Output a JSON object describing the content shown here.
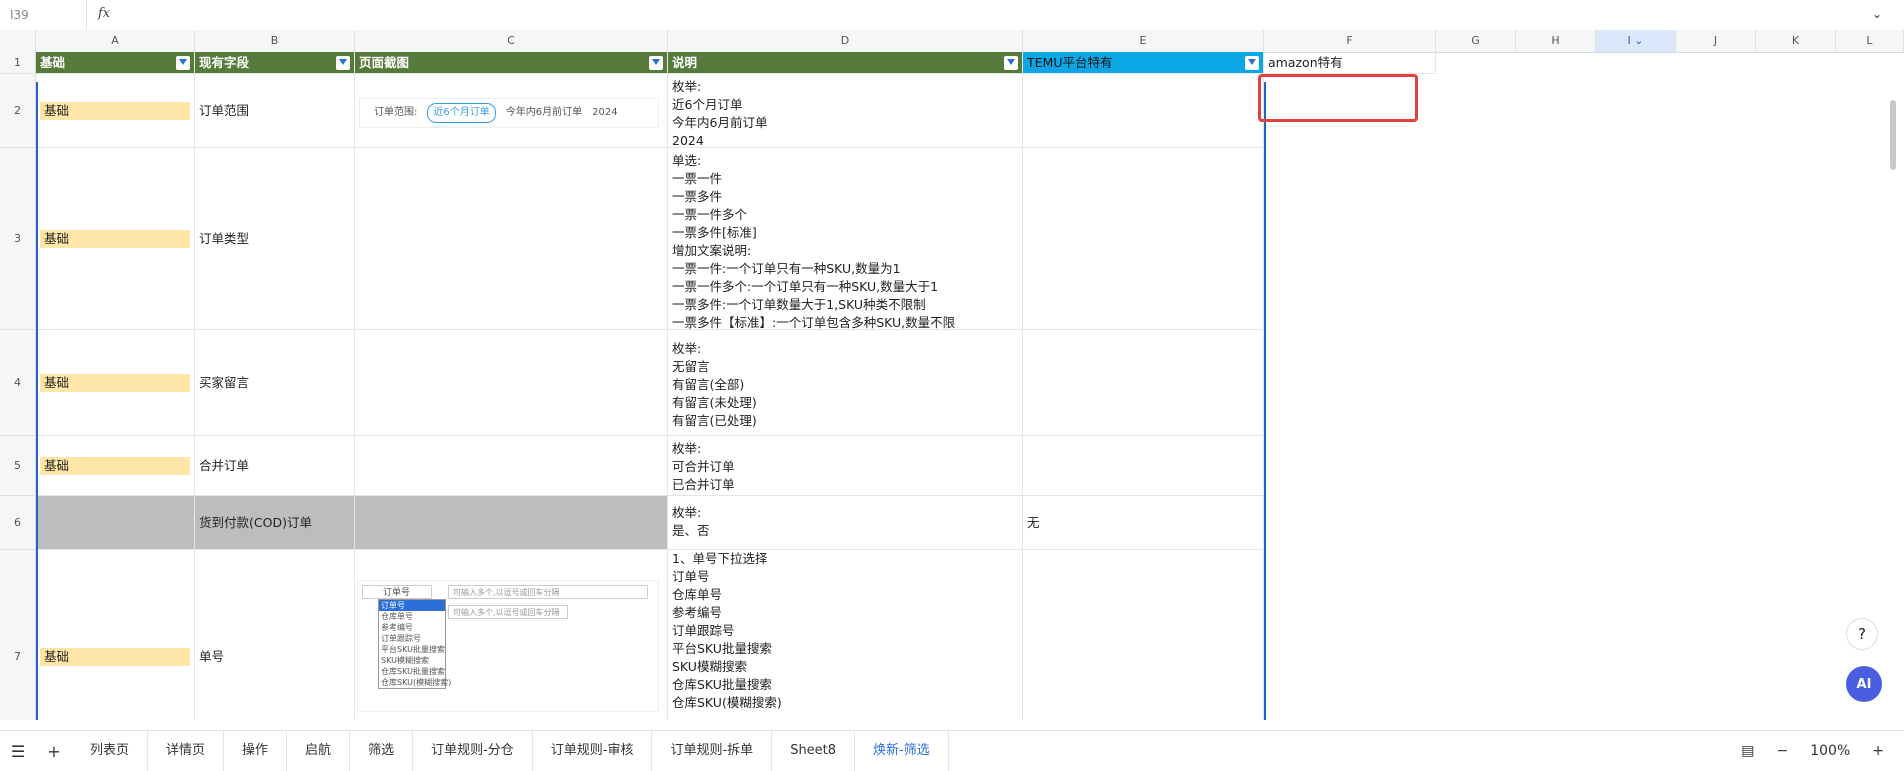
{
  "formula_bar": {
    "cell_ref": "I39",
    "fx": "fx"
  },
  "columns": [
    "A",
    "B",
    "C",
    "D",
    "E",
    "F",
    "G",
    "H",
    "I",
    "J",
    "K",
    "L"
  ],
  "rows": [
    "1",
    "2",
    "3",
    "4",
    "5",
    "6",
    "7"
  ],
  "header_row": {
    "a": "基础",
    "b": "现有字段",
    "c": "页面截图",
    "d": "说明",
    "e": "TEMU平台特有",
    "f": "amazon特有"
  },
  "data_rows": [
    {
      "a": "基础",
      "b": "订单范围",
      "d": "枚举:\n近6个月订单\n今年内6月前订单\n2024",
      "e": ""
    },
    {
      "a": "基础",
      "b": "订单类型",
      "d": "单选:\n一票一件\n一票多件\n一票一件多个\n一票多件[标准]\n增加文案说明:\n一票一件:一个订单只有一种SKU,数量为1\n一票一件多个:一个订单只有一种SKU,数量大于1\n一票多件:一个订单数量大于1,SKU种类不限制\n一票多件【标准】:一个订单包含多种SKU,数量不限",
      "e": ""
    },
    {
      "a": "基础",
      "b": "买家留言",
      "d": "枚举:\n无留言\n有留言(全部)\n有留言(未处理)\n有留言(已处理)",
      "e": ""
    },
    {
      "a": "基础",
      "b": "合并订单",
      "d": "枚举:\n可合并订单\n已合并订单",
      "e": ""
    },
    {
      "a": "",
      "b": "货到付款(COD)订单",
      "d": "枚举:\n是、否",
      "e": "无"
    },
    {
      "a": "基础",
      "b": "单号",
      "d": "1、单号下拉选择\n订单号\n仓库单号\n参考编号\n订单跟踪号\n平台SKU批量搜索\nSKU模糊搜索\n仓库SKU批量搜索\n仓库SKU(模糊搜索)",
      "e": ""
    }
  ],
  "screenshot_order_range": {
    "label": "订单范围:",
    "opt1": "近6个月订单",
    "opt2": "今年内6月前订单",
    "opt3": "2024"
  },
  "screenshot_order_no": {
    "items": [
      "订单号",
      "仓库单号",
      "参考编号",
      "订单跟踪号",
      "平台SKU批量搜索",
      "SKU模糊搜索",
      "仓库SKU批量搜索",
      "仓库SKU(模糊搜索)"
    ],
    "placeholder1": "可输入多个,以逗号或回车分隔",
    "placeholder2": "可输入多个,以逗号或回车分隔"
  },
  "tabs": [
    "列表页",
    "详情页",
    "操作",
    "启航",
    "筛选",
    "订单规则-分仓",
    "订单规则-审核",
    "订单规则-拆单",
    "Sheet8",
    "焕新-筛选"
  ],
  "active_tab_index": 9,
  "zoom": {
    "level": "100%",
    "minus": "−",
    "plus": "+"
  },
  "help_label": "?",
  "ai_label": "AI"
}
